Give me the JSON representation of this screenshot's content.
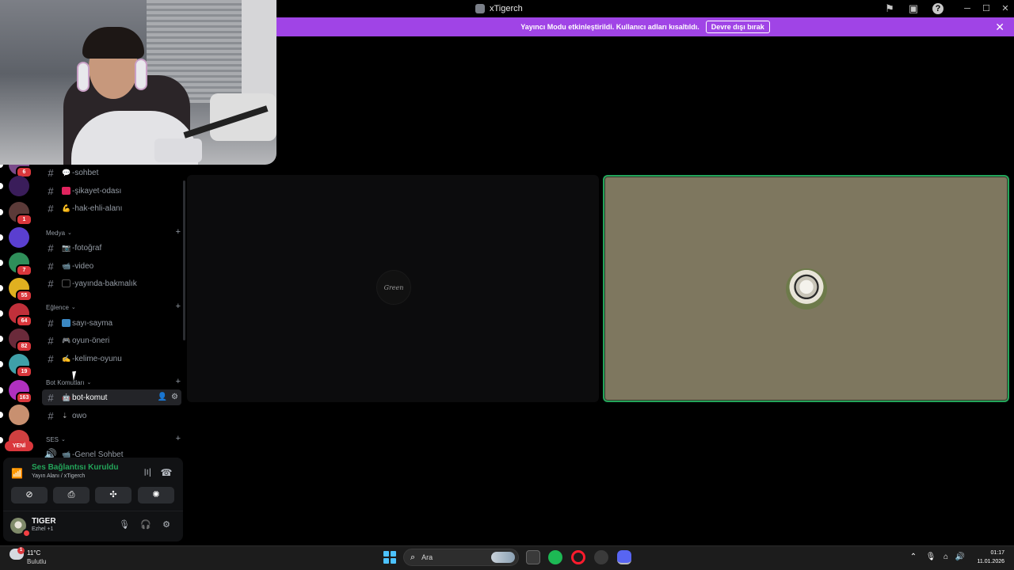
{
  "window": {
    "title": "xTigerch"
  },
  "banner": {
    "text": "Yayıncı Modu etkinleştirildi. Kullanıcı adları kısaltıldı.",
    "button": "Devre dışı bırak"
  },
  "servers": [
    {
      "badge": "6",
      "color": "#7a4a8a"
    },
    {
      "badge": "",
      "color": "#3a1d5a"
    },
    {
      "badge": "1",
      "color": "#5b3a38"
    },
    {
      "badge": "",
      "color": "#5a3fd0"
    },
    {
      "badge": "7",
      "color": "#2f8f5a"
    },
    {
      "badge": "55",
      "color": "#e0b020"
    },
    {
      "badge": "64",
      "color": "#c0303a"
    },
    {
      "badge": "82",
      "color": "#6a2a3a"
    },
    {
      "badge": "19",
      "color": "#3fa0a8"
    },
    {
      "badge": "163",
      "color": "#b030c0"
    },
    {
      "badge": "",
      "color": "#c89070"
    },
    {
      "badge": "",
      "color": "#d04040"
    }
  ],
  "yeni_label": "YENİ",
  "channels": {
    "c1": "-sohbet",
    "c2": "-şikayet-odası",
    "c3": "-hak-ehli-alanı",
    "cat_medya": "Medya",
    "c4": "-fotoğraf",
    "c5": "-video",
    "c6": "-yayında-bakmalık",
    "cat_eglence": "Eğlence",
    "c7": "sayı-sayma",
    "c8": "oyun-öneri",
    "c9": "-kelime-oyunu",
    "cat_bot": "Bot Komutları",
    "c10": "bot-komut",
    "c11": "owo",
    "cat_ses": "SES",
    "c12": "-Genel Sohbet"
  },
  "voice": {
    "status": "Ses Bağlantısı Kuruldu",
    "sub": "Yayın Alanı / xTigerch"
  },
  "user": {
    "name": "TIGER",
    "status": "Ezhel +1"
  },
  "stage": {
    "left_tile_text": "Green"
  },
  "taskbar": {
    "temp": "11°C",
    "condition": "Bulutlu",
    "search": "Ara",
    "weather_badge": "1",
    "time": "01:17",
    "date": "11.01.2026"
  }
}
